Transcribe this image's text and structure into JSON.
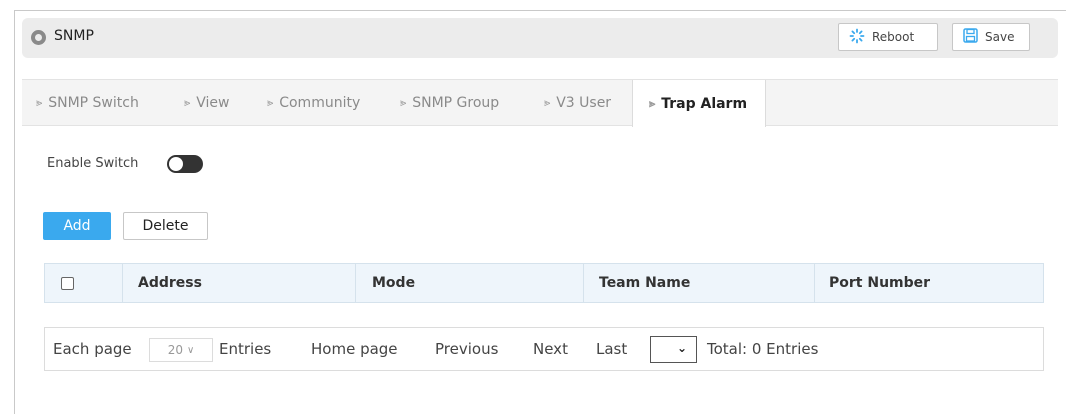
{
  "header": {
    "title": "SNMP",
    "reboot_label": "Reboot",
    "save_label": "Save",
    "reboot_icon": "spinner-icon",
    "save_icon": "floppy-icon",
    "accent": "#3aa9ee"
  },
  "tabs": [
    {
      "label": "SNMP Switch",
      "active": false
    },
    {
      "label": "View",
      "active": false
    },
    {
      "label": "Community",
      "active": false
    },
    {
      "label": "SNMP Group",
      "active": false
    },
    {
      "label": "V3 User",
      "active": false
    },
    {
      "label": "Trap Alarm",
      "active": true
    }
  ],
  "enable_switch": {
    "label": "Enable Switch",
    "on": false
  },
  "actions": {
    "add_label": "Add",
    "delete_label": "Delete"
  },
  "table": {
    "columns": [
      "Address",
      "Mode",
      "Team Name",
      "Port Number"
    ],
    "rows": []
  },
  "pager": {
    "each_page_label": "Each page",
    "page_size": "20",
    "entries_label": "Entries",
    "home_label": "Home page",
    "previous_label": "Previous",
    "next_label": "Next",
    "last_label": "Last",
    "current_page": "",
    "total_label": "Total: 0 Entries"
  }
}
